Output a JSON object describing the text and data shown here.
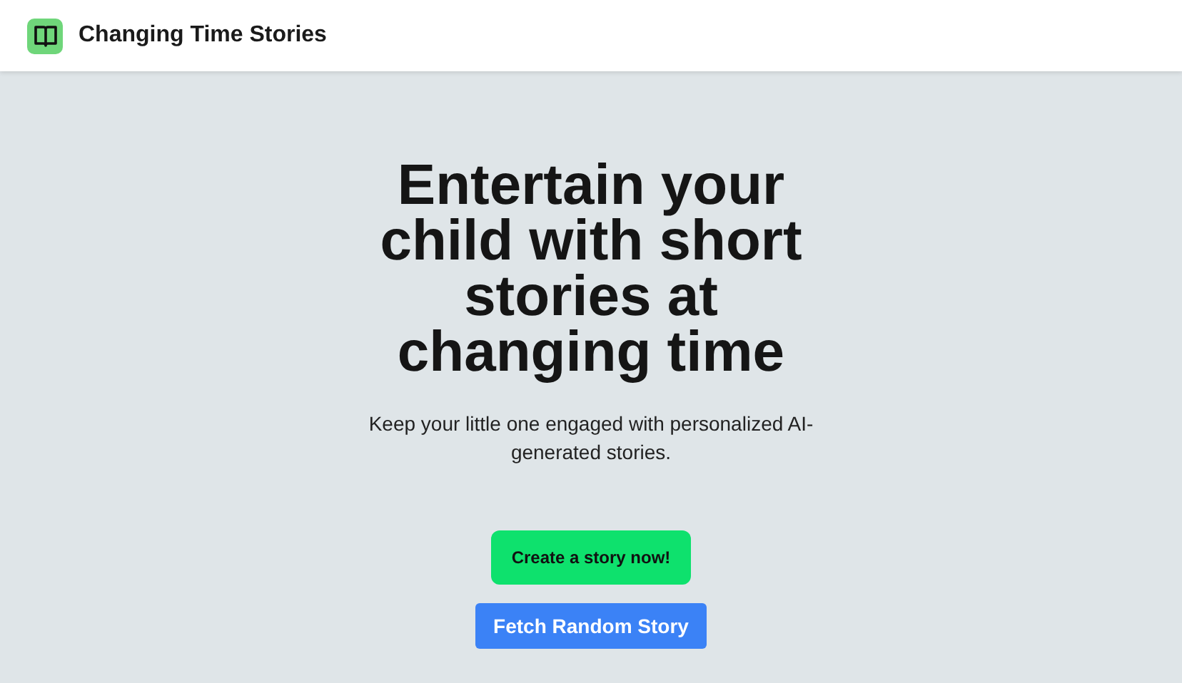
{
  "header": {
    "title": "Changing Time Stories"
  },
  "hero": {
    "headline": "Entertain your child with short stories at changing time",
    "subtitle": "Keep your little one engaged with personalized AI-generated stories."
  },
  "buttons": [
    {
      "label": "Create a story now!",
      "kind": "primary"
    },
    {
      "label": "Fetch Random Story",
      "kind": "secondary"
    }
  ]
}
